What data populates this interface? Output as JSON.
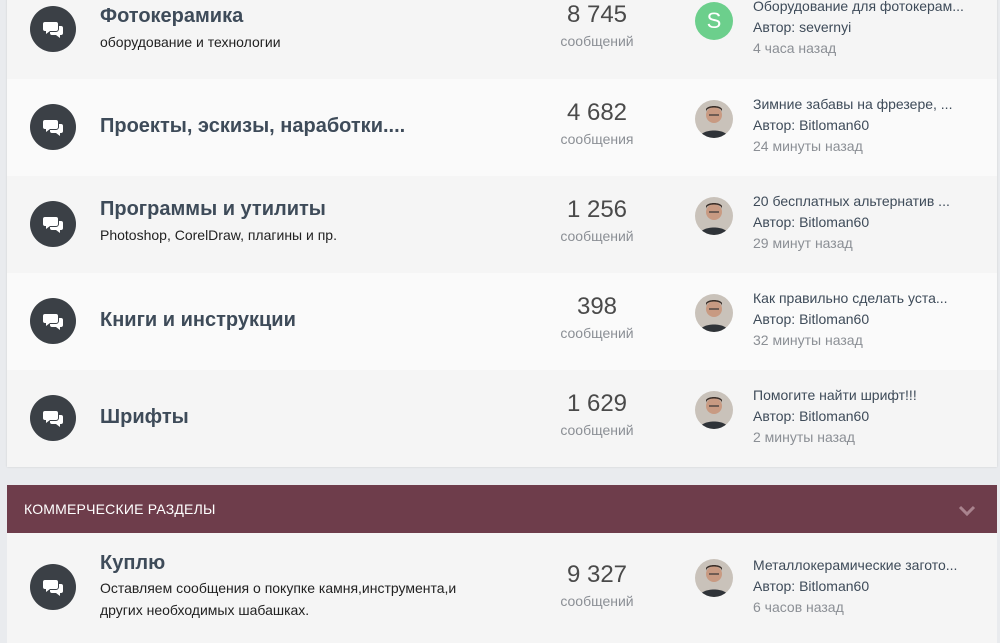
{
  "forums": [
    {
      "title": "Фотокерамика",
      "desc": "оборудование и технологии",
      "count": "8 745",
      "count_label": "сообщений",
      "avatar": "S",
      "topic": "Оборудование для фотокерам...",
      "author": "Автор: severnyi",
      "time": "4 часа назад"
    },
    {
      "title": "Проекты, эскизы, наработки....",
      "desc": "",
      "count": "4 682",
      "count_label": "сообщения",
      "avatar": "",
      "topic": "Зимние забавы на фрезере, ...",
      "author": "Автор: Bitloman60",
      "time": "24 минуты назад"
    },
    {
      "title": "Программы и утилиты",
      "desc": "Photoshop, CorelDraw, плагины и пр.",
      "count": "1 256",
      "count_label": "сообщений",
      "avatar": "",
      "topic": "20 бесплатных альтернатив ...",
      "author": "Автор: Bitloman60",
      "time": "29 минут назад"
    },
    {
      "title": "Книги и инструкции",
      "desc": "",
      "count": "398",
      "count_label": "сообщений",
      "avatar": "",
      "topic": "Как правильно сделать уста...",
      "author": "Автор: Bitloman60",
      "time": "32 минуты назад"
    },
    {
      "title": "Шрифты",
      "desc": "",
      "count": "1 629",
      "count_label": "сообщений",
      "avatar": "",
      "topic": "Помогите найти шрифт!!!",
      "author": "Автор: Bitloman60",
      "time": "2 минуты назад"
    }
  ],
  "category": {
    "title": "КОММЕРЧЕСКИЕ РАЗДЕЛЫ"
  },
  "forum_kuplyu": {
    "title": "Куплю",
    "desc_line1": "Оставляем сообщения о покупке камня,инструмента,и",
    "desc_line2": "других необходимых шабашках.",
    "count": "9 327",
    "count_label": "сообщений",
    "topic": "Металлокерамические загото...",
    "author": "Автор: Bitloman60",
    "time": "6 часов назад"
  },
  "colors": {
    "category_bg": "#6e3d4b",
    "icon_bg": "#3b4046",
    "avatar_s": "#6ccf8c"
  },
  "icons": {
    "forum": "chat-bubbles-icon",
    "toggle": "chevron-down-icon"
  }
}
